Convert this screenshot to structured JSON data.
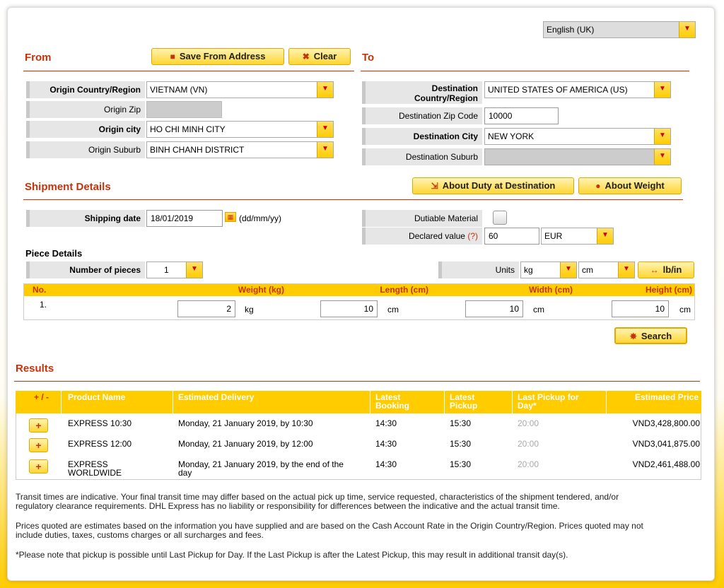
{
  "language": {
    "selected": "English (UK)"
  },
  "from": {
    "title": "From",
    "save_label": "Save From Address",
    "clear_label": "Clear",
    "country_label": "Origin Country/Region",
    "country_value": "VIETNAM (VN)",
    "zip_label": "Origin Zip",
    "city_label": "Origin city",
    "city_value": "HO CHI MINH CITY",
    "suburb_label": "Origin Suburb",
    "suburb_value": "BINH CHANH DISTRICT"
  },
  "to": {
    "title": "To",
    "country_label_1": "Destination",
    "country_label_2": "Country/Region",
    "country_value": "UNITED STATES OF AMERICA (US)",
    "zip_label": "Destination Zip Code",
    "zip_value": "10000",
    "city_label": "Destination City",
    "city_value": "NEW YORK",
    "suburb_label": "Destination Suburb"
  },
  "shipment": {
    "title": "Shipment Details",
    "duty_label": "About Duty at Destination",
    "weight_label": "About Weight",
    "date_label": "Shipping date",
    "date_value": "18/01/2019",
    "date_format": "(dd/mm/yy)",
    "dutiable_label": "Dutiable Material",
    "declared_label": "Declared value",
    "declared_help": "(?)",
    "declared_value": "60",
    "currency": "EUR"
  },
  "pieces": {
    "title": "Piece Details",
    "count_label": "Number of pieces",
    "count_value": "1",
    "units_label": "Units",
    "weight_unit": "kg",
    "length_unit": "cm",
    "toggle_label": "lb/in",
    "col_no": "No.",
    "col_weight": "Weight (kg)",
    "col_length": "Length (cm)",
    "col_width": "Width (cm)",
    "col_height": "Height (cm)",
    "row_no": "1.",
    "weight": "2",
    "length": "10",
    "width": "10",
    "height": "10",
    "kg": "kg",
    "cm": "cm"
  },
  "search_label": "Search",
  "results": {
    "title": "Results",
    "headers": {
      "plusminus": "+ / -",
      "product": "Product Name",
      "delivery": "Estimated Delivery",
      "booking_1": "Latest",
      "booking_2": "Booking",
      "pickup_1": "Latest",
      "pickup_2": "Pickup",
      "lastpickup_1": "Last Pickup for",
      "lastpickup_2": "Day*",
      "price": "Estimated Price"
    },
    "rows": [
      {
        "product_1": "EXPRESS 10:30",
        "product_2": "",
        "delivery_1": "Monday, 21 January 2019, by 10:30",
        "delivery_2": "",
        "booking": "14:30",
        "pickup": "15:30",
        "last": "20:00",
        "price": "VND3,428,800.00"
      },
      {
        "product_1": "EXPRESS 12:00",
        "product_2": "",
        "delivery_1": "Monday, 21 January 2019, by 12:00",
        "delivery_2": "",
        "booking": "14:30",
        "pickup": "15:30",
        "last": "20:00",
        "price": "VND3,041,875.00"
      },
      {
        "product_1": "EXPRESS",
        "product_2": "WORLDWIDE",
        "delivery_1": "Monday, 21 January 2019, by the end of the",
        "delivery_2": "day",
        "booking": "14:30",
        "pickup": "15:30",
        "last": "20:00",
        "price": "VND2,461,488.00"
      }
    ]
  },
  "notes": {
    "transit_1": "Transit times are indicative. Your final transit time may differ based on the actual pick up time, service requested, characteristics of the shipment tendered, and/or",
    "transit_2": "regulatory clearance requirements. DHL Express has no liability or responsibility for differences between the indicative and the actual transit time.",
    "prices_1": "Prices quoted are estimates based on the information you have supplied and are based on the Cash Account Rate in the Origin Country/Region. Prices quoted may not",
    "prices_2": "include duties, taxes, customs charges or all surcharges and fees.",
    "pickup": "*Please note that pickup is possible until Last Pickup for Day. If the Last Pickup is after the Latest Pickup, this may result in additional transit day(s)."
  },
  "colors": {
    "accent": "#c8320a",
    "brand_yellow": "#ffcc00",
    "label_bg": "#e6e6e6"
  }
}
